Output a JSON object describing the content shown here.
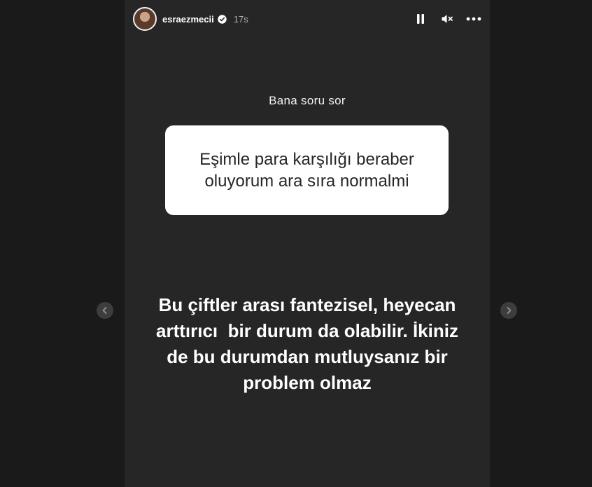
{
  "header": {
    "username": "esraezmecii",
    "time": "17s",
    "controls": [
      {
        "icon": "pause-icon"
      },
      {
        "icon": "muted-speaker-icon"
      },
      {
        "icon": "more-options-icon"
      }
    ]
  },
  "story": {
    "prompt_label": "Bana soru sor",
    "question_lines": [
      "Eşimle para karşılığı beraber",
      "oluyorum ara sıra normalmi"
    ],
    "answer_lines": [
      "Bu çiftler arası fantezisel, heyecan",
      "arttırıcı  bir durum da olabilir. İkiniz",
      "de bu durumdan mutluysanız bir",
      "problem olmaz"
    ]
  },
  "navigation": {
    "prev_icon": "chevron-left-icon",
    "next_icon": "chevron-right-icon"
  },
  "colors": {
    "background": "#1a1a1a",
    "story_background": "#262626",
    "card": "#ffffff",
    "text_light": "#ffffff",
    "text_dark": "#262626",
    "muted": "#b0b0b0"
  }
}
